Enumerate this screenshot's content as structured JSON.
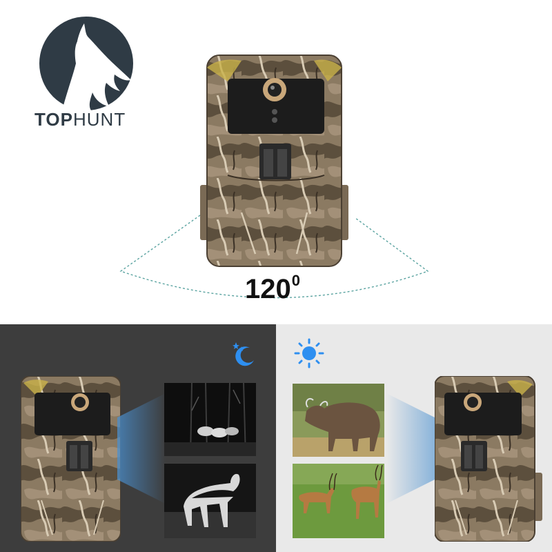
{
  "brand": {
    "name_bold": "TOP",
    "name_light": "HUNT",
    "logo_icon": "howling-wolf-icon",
    "colors": {
      "dark": "#2f3b45"
    }
  },
  "fov": {
    "base": "120",
    "superscript": "0"
  },
  "modes": {
    "night_icon": "moon-stars-icon",
    "day_icon": "sun-icon",
    "accent": "#2e8ff0"
  }
}
